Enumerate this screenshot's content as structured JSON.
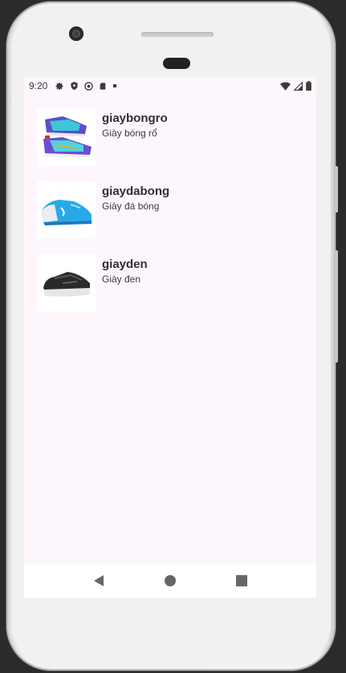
{
  "status_bar": {
    "time": "9:20",
    "left_icons": [
      "gear-icon",
      "shield-icon",
      "no-entry-icon",
      "sd-card-icon",
      "dot-icon"
    ],
    "right_icons": [
      "wifi-icon",
      "signal-icon",
      "battery-icon"
    ]
  },
  "products": [
    {
      "name": "giaybongro",
      "description": "Giày bóng rổ",
      "image": "basketball-shoes-image"
    },
    {
      "name": "giaydabong",
      "description": "Giày đá bóng",
      "image": "football-shoe-image"
    },
    {
      "name": "giayden",
      "description": "Giày đen",
      "image": "black-shoe-image"
    }
  ],
  "nav_bar": [
    "back-icon",
    "home-icon",
    "recents-icon"
  ],
  "colors": {
    "screen_bg": "#fdf7fd",
    "nav_bg": "#ffffff",
    "frame": "#f1f1f1"
  }
}
